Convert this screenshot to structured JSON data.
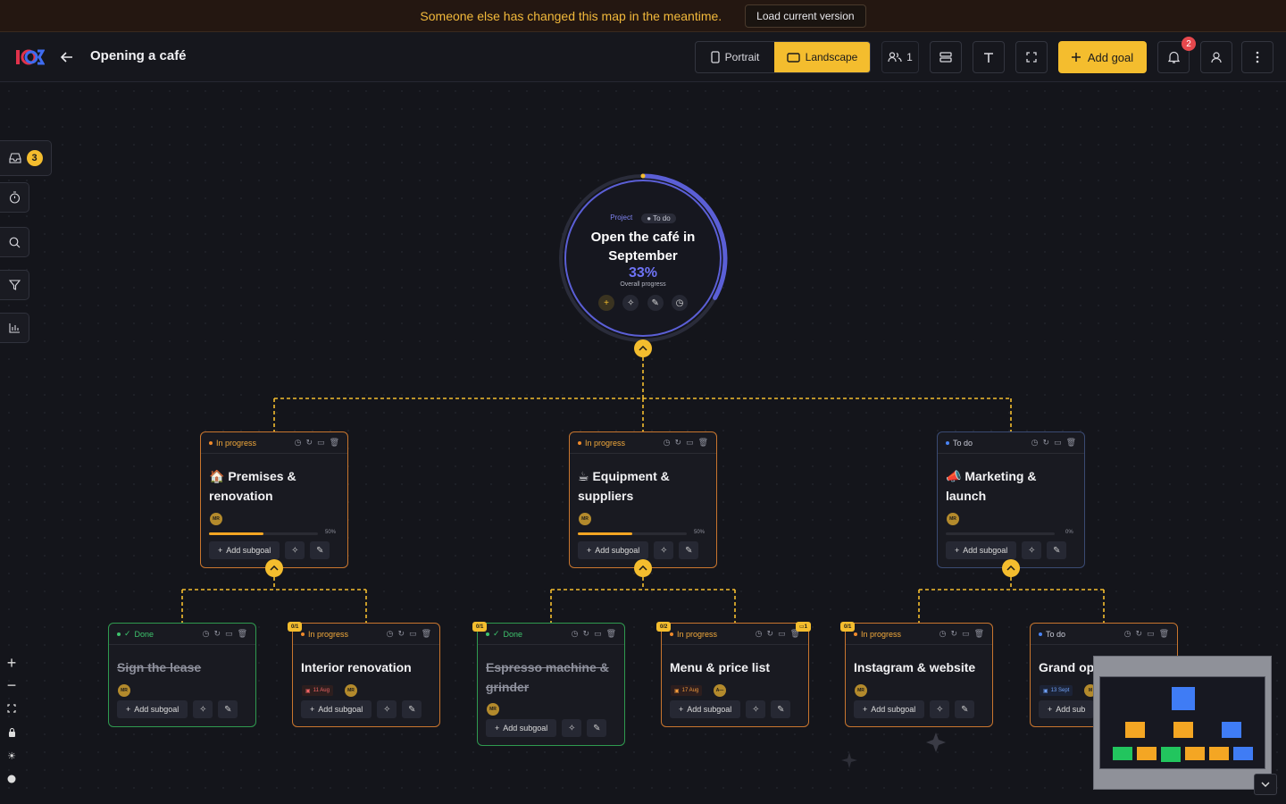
{
  "banner": {
    "message": "Someone else has changed this map in the meantime.",
    "action_label": "Load current version"
  },
  "header": {
    "title": "Opening a café",
    "view": {
      "portrait_label": "Portrait",
      "landscape_label": "Landscape",
      "selected": "Landscape"
    },
    "collaborators_count": "1",
    "add_goal_label": "Add goal",
    "notification_count": "2"
  },
  "sidebar": {
    "inbox_count": "3"
  },
  "root": {
    "tag_type": "Project",
    "status": "To do",
    "title": "Open the café in September",
    "progress": "33%",
    "progress_value": 0.33,
    "progress_caption": "Overall progress"
  },
  "goals": [
    {
      "status": "In progress",
      "title": "🏠 Premises & renovation",
      "avatar": "MR",
      "progress_label": "50%",
      "progress_value": 0.5,
      "add_label": "Add subgoal"
    },
    {
      "status": "In progress",
      "title": "☕ Equipment & suppliers",
      "avatar": "MR",
      "progress_label": "50%",
      "progress_value": 0.5,
      "add_label": "Add subgoal"
    },
    {
      "status": "To do",
      "title": "📣 Marketing & launch",
      "avatar": "MR",
      "progress_label": "0%",
      "progress_value": 0.0,
      "add_label": "Add subgoal"
    }
  ],
  "subgoals": [
    {
      "status": "Done",
      "title": "Sign the lease",
      "avatar": "MR",
      "add_label": "Add subgoal",
      "done": true
    },
    {
      "status": "In progress",
      "title": "Interior renovation",
      "due": "11 Aug",
      "avatar": "MR",
      "tasks": "0/1",
      "add_label": "Add subgoal"
    },
    {
      "status": "Done",
      "title": "Espresso machine & grinder",
      "avatar": "MR",
      "tasks": "0/1",
      "add_label": "Add subgoal",
      "done": true
    },
    {
      "status": "In progress",
      "title": "Menu & price list",
      "due": "17 Aug",
      "avatar": "A—",
      "tasks": "0/2",
      "comments": "1",
      "add_label": "Add subgoal"
    },
    {
      "status": "In progress",
      "title": "Instagram & website",
      "avatar": "MR",
      "tasks": "0/1",
      "add_label": "Add subgoal"
    },
    {
      "status": "To do",
      "title": "Grand op",
      "due": "13 Sept",
      "avatar": "M",
      "add_label": "Add sub"
    }
  ],
  "colors": {
    "accent": "#f4bd2e",
    "in_progress": "#f08a2b",
    "done": "#3ec46d",
    "todo": "#4a84f5",
    "root_ring": "#5b5fd6"
  }
}
